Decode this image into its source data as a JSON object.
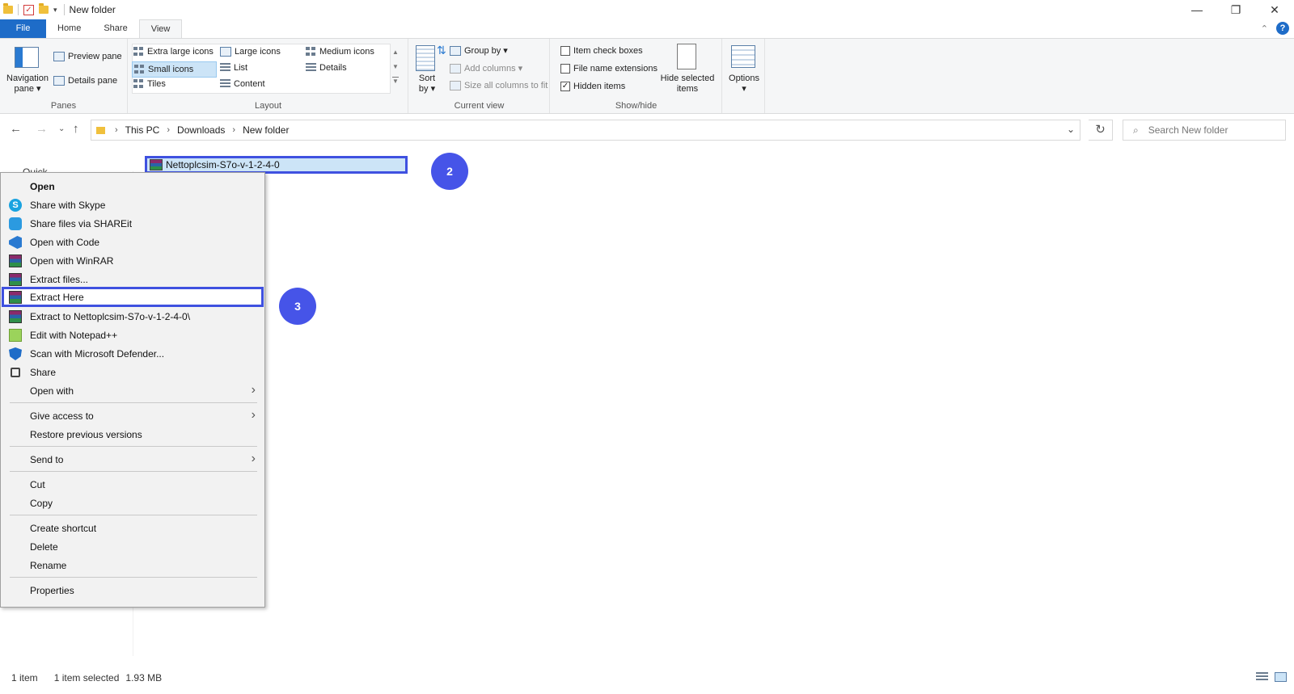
{
  "window": {
    "title": "New folder",
    "controls": {
      "minimize": "—",
      "maximize": "❐",
      "close": "✕"
    }
  },
  "ribbon_tabs": [
    {
      "label": "File"
    },
    {
      "label": "Home"
    },
    {
      "label": "Share"
    },
    {
      "label": "View"
    }
  ],
  "ribbon": {
    "panes": {
      "group_label": "Panes",
      "navigation_pane": "Navigation",
      "navigation_pane_line2": "pane ▾",
      "preview_pane": "Preview pane",
      "details_pane": "Details pane"
    },
    "layout": {
      "group_label": "Layout",
      "items": [
        "Extra large icons",
        "Large icons",
        "Medium icons",
        "Small icons",
        "List",
        "Details",
        "Tiles",
        "Content"
      ],
      "selected": "Small icons"
    },
    "current_view": {
      "group_label": "Current view",
      "sort_by": "Sort",
      "sort_by_line2": "by ▾",
      "group_by": "Group by ▾",
      "add_columns": "Add columns ▾",
      "size_all_columns": "Size all columns to fit"
    },
    "show_hide": {
      "group_label": "Show/hide",
      "item_check_boxes": "Item check boxes",
      "file_name_extensions": "File name extensions",
      "hidden_items": "Hidden items",
      "hide_selected": "Hide selected",
      "hide_selected_line2": "items"
    },
    "options": {
      "label": "Options",
      "label_line2": "▾"
    }
  },
  "address_bar": {
    "crumbs": [
      "This PC",
      "Downloads",
      "New folder"
    ],
    "search_placeholder": "Search New folder"
  },
  "nav_pane": {
    "quick_access_partial": "Quick"
  },
  "file": {
    "name": "Nettoplcsim-S7o-v-1-2-4-0"
  },
  "annotations": {
    "step2": "2",
    "step3": "3"
  },
  "context_menu": {
    "items": [
      {
        "label": "Open",
        "icon": "none"
      },
      {
        "label": "Share with Skype",
        "icon": "skype-icon"
      },
      {
        "label": "Share files via SHAREit",
        "icon": "shareit-icon"
      },
      {
        "label": "Open with Code",
        "icon": "vscode-icon"
      },
      {
        "label": "Open with WinRAR",
        "icon": "winrar-icon"
      },
      {
        "label": "Extract files...",
        "icon": "winrar-icon"
      },
      {
        "label": "Extract Here",
        "icon": "winrar-icon"
      },
      {
        "label": "Extract to Nettoplcsim-S7o-v-1-2-4-0\\",
        "icon": "winrar-icon"
      },
      {
        "label": "Edit with Notepad++",
        "icon": "notepadpp-icon"
      },
      {
        "label": "Scan with Microsoft Defender...",
        "icon": "defender-icon"
      },
      {
        "label": "Share",
        "icon": "share-icon"
      },
      {
        "label": "Open with",
        "icon": "none"
      },
      {
        "label": "Give access to",
        "icon": "none"
      },
      {
        "label": "Restore previous versions",
        "icon": "none"
      },
      {
        "label": "Send to",
        "icon": "none"
      },
      {
        "label": "Cut",
        "icon": "none"
      },
      {
        "label": "Copy",
        "icon": "none"
      },
      {
        "label": "Create shortcut",
        "icon": "none"
      },
      {
        "label": "Delete",
        "icon": "none"
      },
      {
        "label": "Rename",
        "icon": "none"
      },
      {
        "label": "Properties",
        "icon": "none"
      }
    ]
  },
  "status_bar": {
    "item_count": "1 item",
    "selected": "1 item selected",
    "size": "1.93 MB"
  },
  "colors": {
    "accent_blue": "#1e6cc8",
    "annotation_blue": "#4654e8",
    "highlight_border": "#3f51e0",
    "selection_fill": "#cce4f7"
  }
}
